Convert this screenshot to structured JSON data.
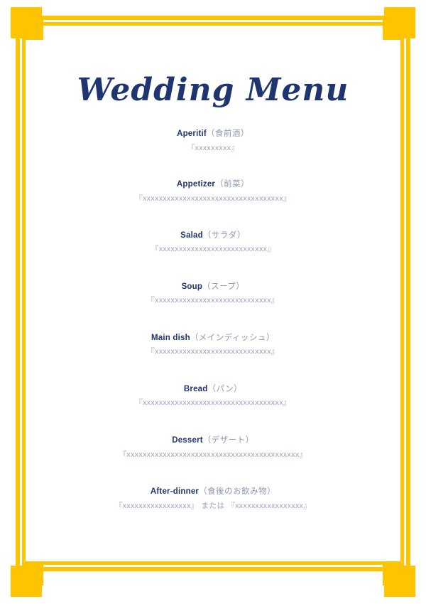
{
  "document": {
    "title": "Wedding Menu",
    "title_color": "#1f3570",
    "frame_color": "#ffc400",
    "background_color": "#ffffff",
    "body_text_color": "#9aa2c0",
    "heading_color": "#1f3570",
    "jp_label_color": "#8e96b6"
  },
  "courses": [
    {
      "name": "Aperitif",
      "jp": "（食前酒）",
      "value": "『xxxxxxxxx』"
    },
    {
      "name": "Appetizer",
      "jp": "（前菜）",
      "value": "『xxxxxxxxxxxxxxxxxxxxxxxxxxxxxxxxxxx』"
    },
    {
      "name": "Salad",
      "jp": "（サラダ）",
      "value": "『xxxxxxxxxxxxxxxxxxxxxxxxxxx』"
    },
    {
      "name": "Soup",
      "jp": "（スープ）",
      "value": "『xxxxxxxxxxxxxxxxxxxxxxxxxxxxx』"
    },
    {
      "name": "Main dish",
      "jp": "（メインディッシュ）",
      "value": "『xxxxxxxxxxxxxxxxxxxxxxxxxxxxx』"
    },
    {
      "name": "Bread",
      "jp": "（パン）",
      "value": "『xxxxxxxxxxxxxxxxxxxxxxxxxxxxxxxxxxx』"
    },
    {
      "name": "Dessert",
      "jp": "（デザート）",
      "value": "『xxxxxxxxxxxxxxxxxxxxxxxxxxxxxxxxxxxxxxxxxxx』"
    },
    {
      "name": "After-dinner",
      "jp": "（食後のお飲み物）",
      "value_first": "『xxxxxxxxxxxxxxxxx』",
      "conjunction": "または",
      "value_second": "『xxxxxxxxxxxxxxxxx』"
    }
  ]
}
